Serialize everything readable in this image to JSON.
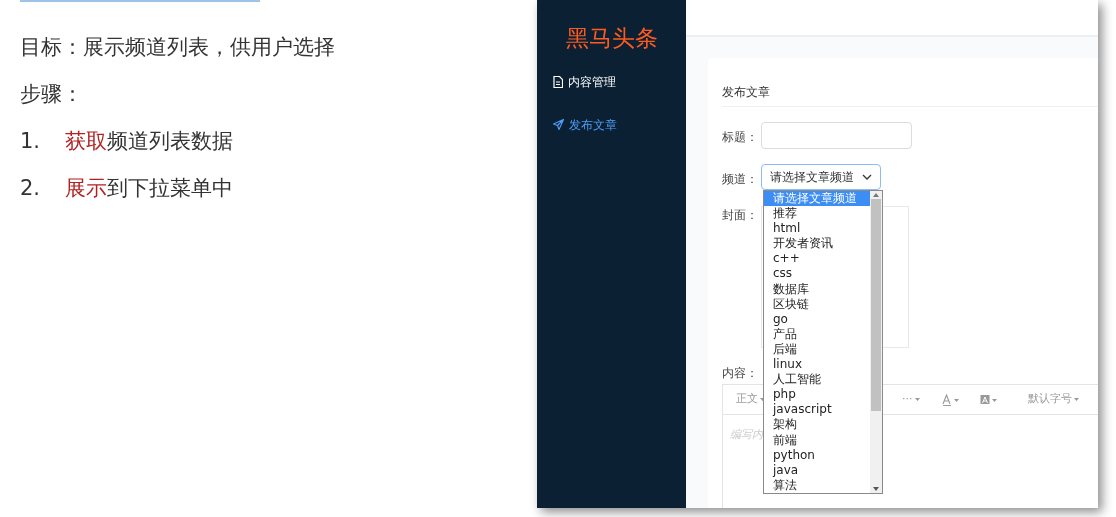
{
  "slide": {
    "goal": "目标：展示频道列表，供用户选择",
    "steps_label": "步骤：",
    "steps": [
      {
        "number": "1.",
        "highlight": "获取",
        "text": "频道列表数据"
      },
      {
        "number": "2.",
        "highlight": "展示",
        "text": "到下拉菜单中"
      }
    ]
  },
  "app": {
    "logo": "黑马头条",
    "sidebar": {
      "items": [
        {
          "label": "内容管理",
          "kind": "document",
          "selected": false
        },
        {
          "label": "发布文章",
          "kind": "send",
          "selected": true
        }
      ]
    },
    "card": {
      "title": "发布文章",
      "form": {
        "title_label": "标题：",
        "channel_label": "频道：",
        "channel_value": "请选择文章频道",
        "cover_label": "封面：",
        "content_label": "内容：",
        "editor": {
          "toolbar": [
            {
              "kind": "dropdown",
              "label": "正文"
            },
            {
              "kind": "dropdown",
              "label": "···"
            },
            {
              "kind": "font-color"
            },
            {
              "kind": "background-color"
            },
            {
              "kind": "dropdown",
              "label": "默认字号"
            }
          ],
          "placeholder": "编写内"
        }
      }
    },
    "dropdown": {
      "options": [
        {
          "label": "请选择文章频道",
          "selected": true
        },
        {
          "label": "推荐",
          "selected": false
        },
        {
          "label": "html",
          "selected": false
        },
        {
          "label": "开发者资讯",
          "selected": false
        },
        {
          "label": "c++",
          "selected": false
        },
        {
          "label": "css",
          "selected": false
        },
        {
          "label": "数据库",
          "selected": false
        },
        {
          "label": "区块链",
          "selected": false
        },
        {
          "label": "go",
          "selected": false
        },
        {
          "label": "产品",
          "selected": false
        },
        {
          "label": "后端",
          "selected": false
        },
        {
          "label": "linux",
          "selected": false
        },
        {
          "label": "人工智能",
          "selected": false
        },
        {
          "label": "php",
          "selected": false
        },
        {
          "label": "javascript",
          "selected": false
        },
        {
          "label": "架构",
          "selected": false
        },
        {
          "label": "前端",
          "selected": false
        },
        {
          "label": "python",
          "selected": false
        },
        {
          "label": "java",
          "selected": false
        },
        {
          "label": "算法",
          "selected": false
        }
      ]
    }
  }
}
